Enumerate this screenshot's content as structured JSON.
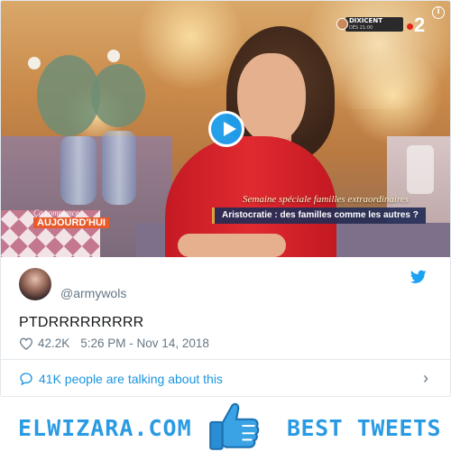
{
  "video": {
    "channel_badge": "DIXICENT",
    "channel_badge_sub": "DÈS 21:00",
    "network": "2",
    "lower_third_super": "Semaine spéciale familles extraordinaires",
    "lower_third": "Aristocratie : des familles comme les autres ?",
    "show_logo_top": "Ça commence",
    "show_logo_main": "AUJOURD'HUI",
    "info_label": "i"
  },
  "tweet": {
    "handle": "@armywols",
    "text": "PTDRRRRRRRRR",
    "likes": "42.2K",
    "timestamp": "5:26 PM - Nov 14, 2018",
    "talking": "41K people are talking about this",
    "chevron": "›"
  },
  "banner": {
    "left": "ELWIZARA.COM",
    "right": "BEST TWEETS"
  },
  "colors": {
    "twitter_blue": "#1da1f2",
    "link_blue": "#1b95e0",
    "meta_gray": "#657786",
    "banner_blue": "#2a9be3"
  },
  "icons": {
    "play": "play-icon",
    "info": "info-icon",
    "bird": "twitter-bird-icon",
    "heart": "heart-icon",
    "bubble": "speech-bubble-icon",
    "chevron": "chevron-right-icon",
    "thumb": "thumbs-up-icon"
  }
}
